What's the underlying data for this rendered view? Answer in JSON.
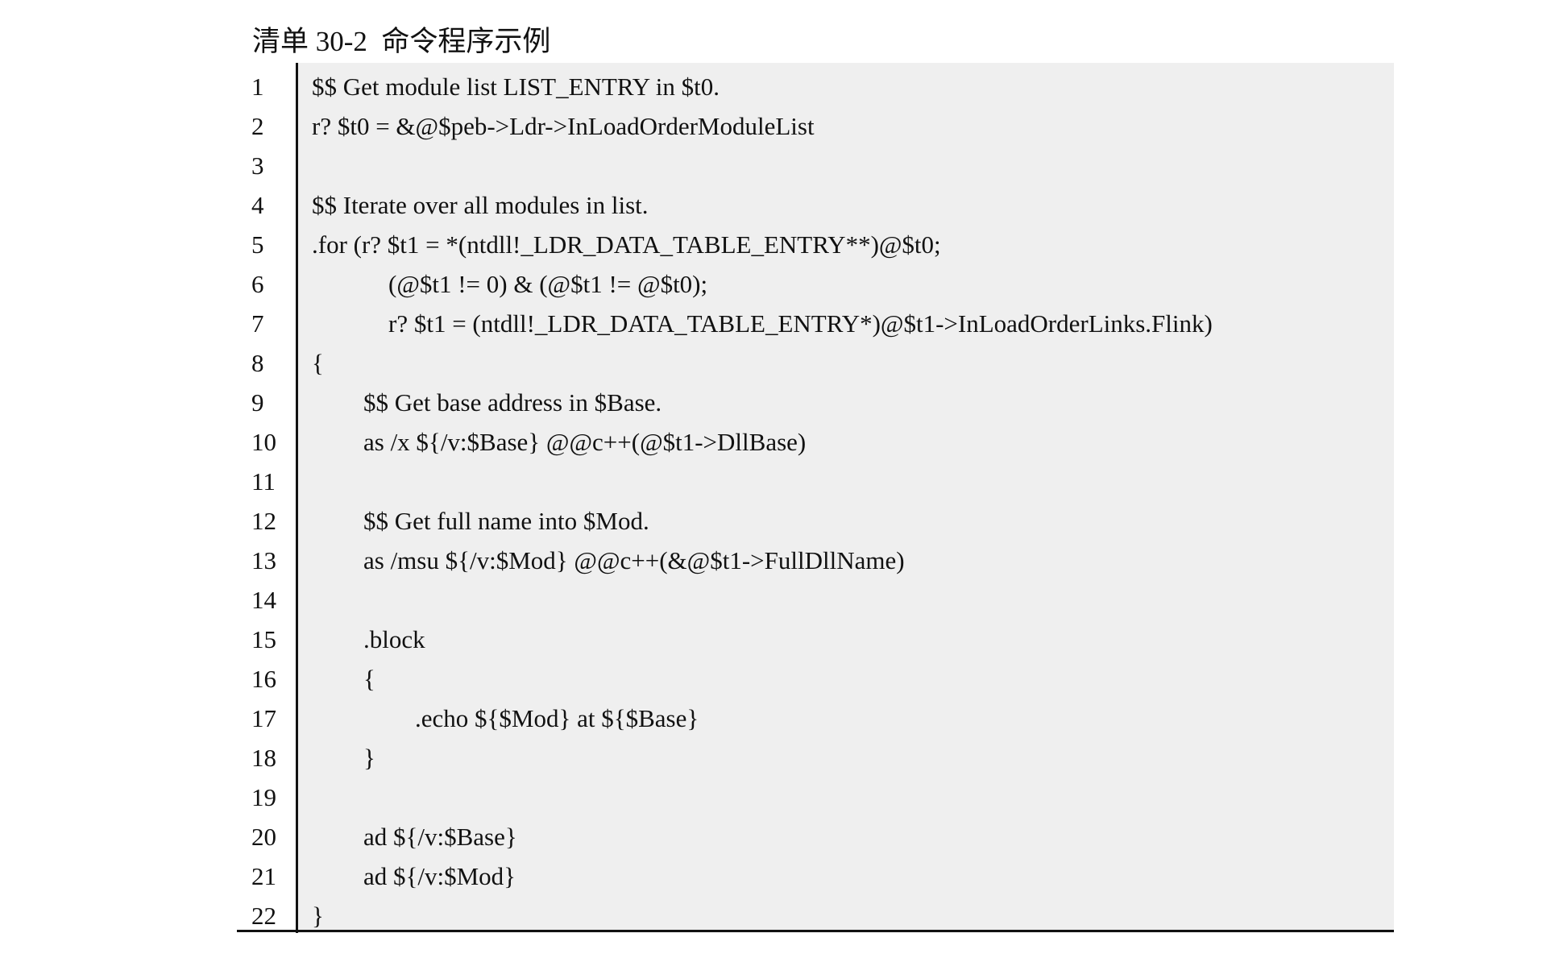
{
  "caption": "清单 30-2  命令程序示例",
  "lines": [
    {
      "num": "1",
      "indent": 0,
      "code": "$$ Get module list LIST_ENTRY in $t0."
    },
    {
      "num": "2",
      "indent": 0,
      "code": "r? $t0 = &@$peb->Ldr->InLoadOrderModuleList"
    },
    {
      "num": "3",
      "indent": 0,
      "code": ""
    },
    {
      "num": "4",
      "indent": 0,
      "code": "$$ Iterate over all modules in list."
    },
    {
      "num": "5",
      "indent": 0,
      "code": ".for (r? $t1 = *(ntdll!_LDR_DATA_TABLE_ENTRY**)@$t0;"
    },
    {
      "num": "6",
      "indent": 2,
      "code": "(@$t1 != 0) & (@$t1 != @$t0);"
    },
    {
      "num": "7",
      "indent": 2,
      "code": "r? $t1 = (ntdll!_LDR_DATA_TABLE_ENTRY*)@$t1->InLoadOrderLinks.Flink)"
    },
    {
      "num": "8",
      "indent": 0,
      "code": "{"
    },
    {
      "num": "9",
      "indent": 1,
      "code": "$$ Get base address in $Base."
    },
    {
      "num": "10",
      "indent": 1,
      "code": "as /x ${/v:$Base} @@c++(@$t1->DllBase)"
    },
    {
      "num": "11",
      "indent": 0,
      "code": ""
    },
    {
      "num": "12",
      "indent": 1,
      "code": "$$ Get full name into $Mod."
    },
    {
      "num": "13",
      "indent": 1,
      "code": "as /msu ${/v:$Mod} @@c++(&@$t1->FullDllName)"
    },
    {
      "num": "14",
      "indent": 0,
      "code": ""
    },
    {
      "num": "15",
      "indent": 1,
      "code": ".block"
    },
    {
      "num": "16",
      "indent": 1,
      "code": "{"
    },
    {
      "num": "17",
      "indent": 3,
      "code": ".echo ${$Mod} at ${$Base}"
    },
    {
      "num": "18",
      "indent": 1,
      "code": "}"
    },
    {
      "num": "19",
      "indent": 0,
      "code": ""
    },
    {
      "num": "20",
      "indent": 1,
      "code": "ad ${/v:$Base}"
    },
    {
      "num": "21",
      "indent": 1,
      "code": "ad ${/v:$Mod}"
    },
    {
      "num": "22",
      "indent": 0,
      "code": "}"
    }
  ]
}
